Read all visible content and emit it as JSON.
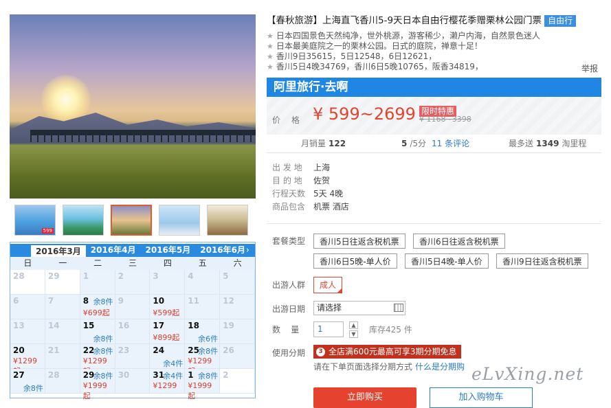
{
  "gallery": {
    "main_image": "sunset-meadow-bridge-photo",
    "thumbnails": [
      "coast-aerial",
      "garden-lake",
      "sunset-meadow",
      "windmill",
      "two-people"
    ],
    "thumb_badge": "599",
    "selected_index": 2
  },
  "calendar": {
    "months": [
      "2016年3月",
      "2016年4月",
      "2016年5月",
      "2016年6月"
    ],
    "active_month": 0,
    "next_icon": "chevron-right-icon",
    "next_label": "›",
    "weekdays": [
      "日",
      "一",
      "二",
      "三",
      "四",
      "五",
      "六"
    ],
    "weeks": [
      [
        {
          "d": "28"
        },
        {
          "d": "29"
        },
        {
          "d": "1"
        },
        {
          "d": "2"
        },
        {
          "d": "3"
        },
        {
          "d": "4"
        },
        {
          "d": "5"
        }
      ],
      [
        {
          "d": "6"
        },
        {
          "d": "7"
        },
        {
          "d": "8",
          "r": "余8件",
          "p": "¥699起",
          "a": true
        },
        {
          "d": "9"
        },
        {
          "d": "10",
          "p": "¥599起",
          "a": true
        },
        {
          "d": "11"
        },
        {
          "d": "12"
        }
      ],
      [
        {
          "d": "13"
        },
        {
          "d": "14"
        },
        {
          "d": "15",
          "r": "余8件",
          "a": true
        },
        {
          "d": "16"
        },
        {
          "d": "17",
          "p": "¥899起",
          "a": true
        },
        {
          "d": "18",
          "r": "余6件",
          "a": true
        },
        {
          "d": "19"
        }
      ],
      [
        {
          "d": "20",
          "p": "¥1299起",
          "a": true
        },
        {
          "d": "21"
        },
        {
          "d": "22",
          "r": "余8件",
          "p": "¥1299起",
          "a": true
        },
        {
          "d": "23"
        },
        {
          "d": "24",
          "r": "余4件",
          "a": true
        },
        {
          "d": "25",
          "r": "余8件",
          "p": "¥1299起",
          "a": true
        },
        {
          "d": "26"
        }
      ],
      [
        {
          "d": "27",
          "r": "余8件",
          "a": true
        },
        {
          "d": "28"
        },
        {
          "d": "29",
          "r": "余8件",
          "p": "¥1999起",
          "a": true
        },
        {
          "d": "30"
        },
        {
          "d": "31",
          "r": "余4件",
          "p": "¥1299",
          "a": true
        },
        {
          "d": "1",
          "r": "余8件",
          "p": "¥1999起",
          "a": true
        },
        {
          "d": "2"
        }
      ]
    ]
  },
  "product": {
    "title": "【春秋旅游】上海直飞香川5-9天日本自由行樱花季赠栗林公园门票",
    "tag": "自由行",
    "features": [
      "日本四国景色天然纯净，世外桃源，游客稀少，濑户内海，自然景色迷人",
      "日本最美庭院之一的栗林公园。日式的庭院，禅意十足！",
      "香川9日35615，5日12548，6日12621，",
      "香川5日4晚34769，香川6日5晚10765，阪香34819，"
    ],
    "report": "举报",
    "seller": "阿里旅行·去啊",
    "price_label": "价格",
    "price": "¥ 599~2699",
    "promo": "限时特惠",
    "old_price": "¥ 1168~3398",
    "stats": {
      "monthly_label": "月销量",
      "monthly": "122",
      "rating": "5",
      "rating_suffix": "/5分",
      "reviews": "11 条评论",
      "points_label": "最多送",
      "points": "1349",
      "points_suffix": "淘里程"
    },
    "info": [
      {
        "label": "出 发 地",
        "value": "上海"
      },
      {
        "label": "目 的 地",
        "value": "佐贺"
      },
      {
        "label": "行程天数",
        "value": "5天 4晚"
      },
      {
        "label": "商品包含",
        "value": "机票  酒店"
      }
    ],
    "package_label": "套餐类型",
    "packages": [
      "香川5日往返含税机票",
      "香川6日往返含税机票",
      "香川6日5晚-单人价",
      "香川5日4晚-单人价",
      "香川9日往返含税机票"
    ],
    "traveler_label": "出游人群",
    "traveler": "成人",
    "date_label": "出游日期",
    "date_placeholder": "请选择",
    "qty_label": "数    量",
    "qty": "1",
    "stock": "库存425 件",
    "install_label": "使用分期",
    "install_banner": "全店满600元最高可享3期分期免息",
    "install_note": "请在下单页面选择分期方式",
    "install_link": "什么是分期购",
    "buy": "立即购买",
    "cart": "加入购物车"
  },
  "watermark": "eLvXing.net"
}
